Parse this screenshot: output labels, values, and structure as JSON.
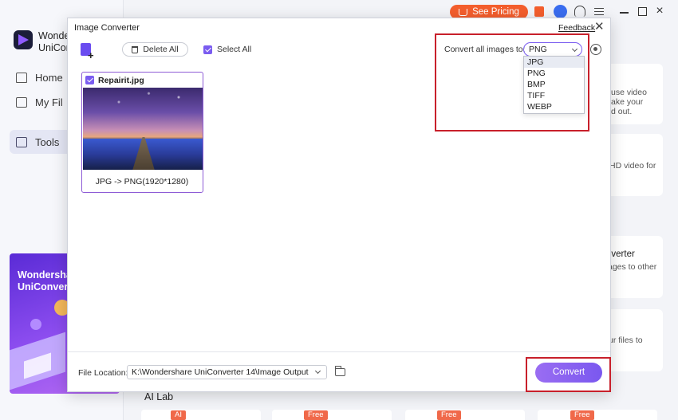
{
  "app": {
    "logo_text_1": "Wonder",
    "logo_text_2": "UniConv",
    "nav": [
      {
        "label": "Home"
      },
      {
        "label": "My Fil"
      },
      {
        "label": "Tools"
      }
    ],
    "promo_title_1": "Wondershar",
    "promo_title_2": "UniConverte",
    "see_pricing": "See Pricing",
    "ai_lab": "AI Lab",
    "cards": [
      {
        "lines": [
          "use video",
          "ake your",
          "d out."
        ]
      },
      {
        "lines": [
          "HD video for"
        ]
      },
      {
        "lines": [
          "nverter",
          "ages to other"
        ]
      },
      {
        "lines": [
          "ur files to"
        ]
      }
    ],
    "tags": [
      "AI",
      "Free",
      "Free",
      "Free"
    ]
  },
  "dialog": {
    "title": "Image Converter",
    "feedback": "Feedback",
    "delete_all": "Delete All",
    "select_all": "Select All",
    "convert_all_label": "Convert all images to:",
    "format_selected": "PNG",
    "format_options": [
      "JPG",
      "PNG",
      "BMP",
      "TIFF",
      "WEBP"
    ],
    "image": {
      "name": "Repairit.jpg",
      "info": "JPG -> PNG(1920*1280)"
    },
    "file_location_label": "File Location:",
    "file_location_value": "K:\\Wondershare UniConverter 14\\Image Output",
    "convert_button": "Convert"
  },
  "colors": {
    "accent": "#7a58ef",
    "pricing": "#f45e2d",
    "highlight": "#c8202b"
  }
}
